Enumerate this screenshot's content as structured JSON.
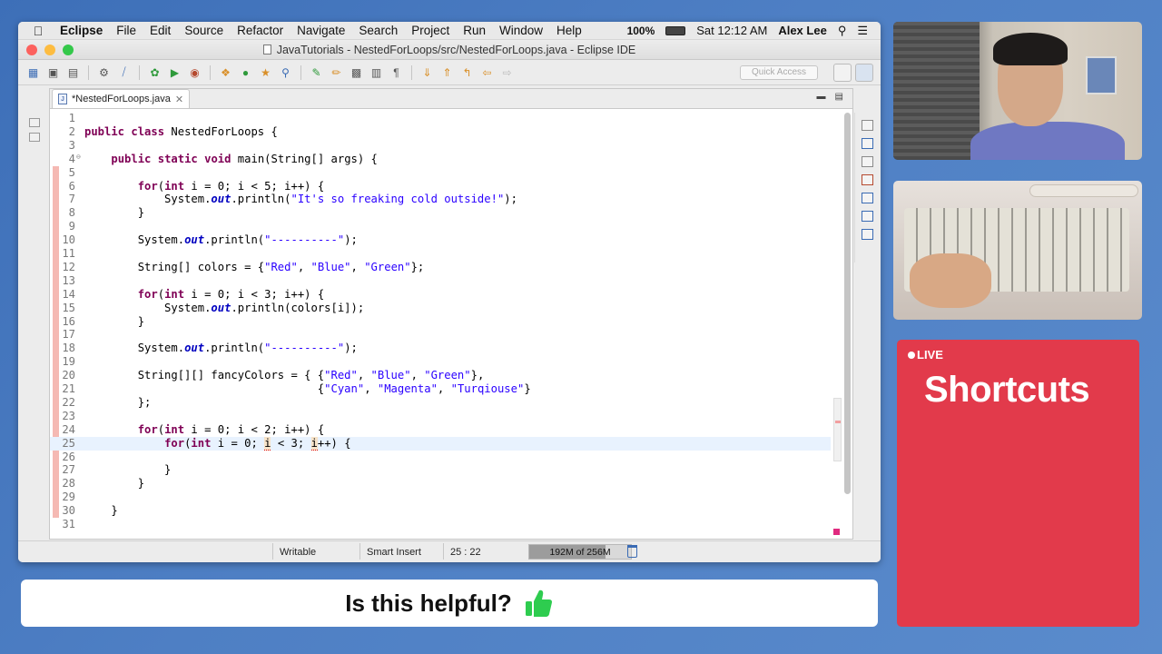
{
  "menubar": {
    "app_name": "Eclipse",
    "menus": [
      "File",
      "Edit",
      "Source",
      "Refactor",
      "Navigate",
      "Search",
      "Project",
      "Run",
      "Window",
      "Help"
    ],
    "battery": "100%",
    "clock": "Sat 12:12 AM",
    "user": "Alex Lee"
  },
  "window": {
    "title": "JavaTutorials - NestedForLoops/src/NestedForLoops.java - Eclipse IDE"
  },
  "toolbar": {
    "quick_access_placeholder": "Quick Access"
  },
  "editor": {
    "tab_label": "*NestedForLoops.java",
    "lines": [
      {
        "n": "1",
        "code": ""
      },
      {
        "n": "2",
        "code": "public class NestedForLoops {"
      },
      {
        "n": "3",
        "code": ""
      },
      {
        "n": "4",
        "code": "    public static void main(String[] args) {"
      },
      {
        "n": "5",
        "code": ""
      },
      {
        "n": "6",
        "code": "        for(int i = 0; i < 5; i++) {"
      },
      {
        "n": "7",
        "code": "            System.out.println(\"It's so freaking cold outside!\");"
      },
      {
        "n": "8",
        "code": "        }"
      },
      {
        "n": "9",
        "code": ""
      },
      {
        "n": "10",
        "code": "        System.out.println(\"----------\");"
      },
      {
        "n": "11",
        "code": ""
      },
      {
        "n": "12",
        "code": "        String[] colors = {\"Red\", \"Blue\", \"Green\"};"
      },
      {
        "n": "13",
        "code": ""
      },
      {
        "n": "14",
        "code": "        for(int i = 0; i < 3; i++) {"
      },
      {
        "n": "15",
        "code": "            System.out.println(colors[i]);"
      },
      {
        "n": "16",
        "code": "        }"
      },
      {
        "n": "17",
        "code": ""
      },
      {
        "n": "18",
        "code": "        System.out.println(\"----------\");"
      },
      {
        "n": "19",
        "code": ""
      },
      {
        "n": "20",
        "code": "        String[][] fancyColors = { {\"Red\", \"Blue\", \"Green\"},"
      },
      {
        "n": "21",
        "code": "                                   {\"Cyan\", \"Magenta\", \"Turqiouse\"}"
      },
      {
        "n": "22",
        "code": "        };"
      },
      {
        "n": "23",
        "code": ""
      },
      {
        "n": "24",
        "code": "        for(int i = 0; i < 2; i++) {"
      },
      {
        "n": "25",
        "code": "            for(int i = 0; i < 3; i++) {"
      },
      {
        "n": "26",
        "code": ""
      },
      {
        "n": "27",
        "code": "            }"
      },
      {
        "n": "28",
        "code": "        }"
      },
      {
        "n": "29",
        "code": ""
      },
      {
        "n": "30",
        "code": "    }"
      },
      {
        "n": "31",
        "code": ""
      }
    ],
    "current_line": "25"
  },
  "statusbar": {
    "mode": "Writable",
    "insert_mode": "Smart Insert",
    "position": "25 : 22",
    "heap": "192M of 256M",
    "heap_fraction": 0.75
  },
  "overlay": {
    "live_label": "LIVE",
    "live_title": "Shortcuts",
    "helpful_question": "Is this helpful?"
  },
  "colors": {
    "background": "#4a7bc2",
    "live_panel": "#e23a4b",
    "thumbs_up": "#2ecc4f",
    "keyword": "#7f0055",
    "string": "#2a00ff"
  }
}
